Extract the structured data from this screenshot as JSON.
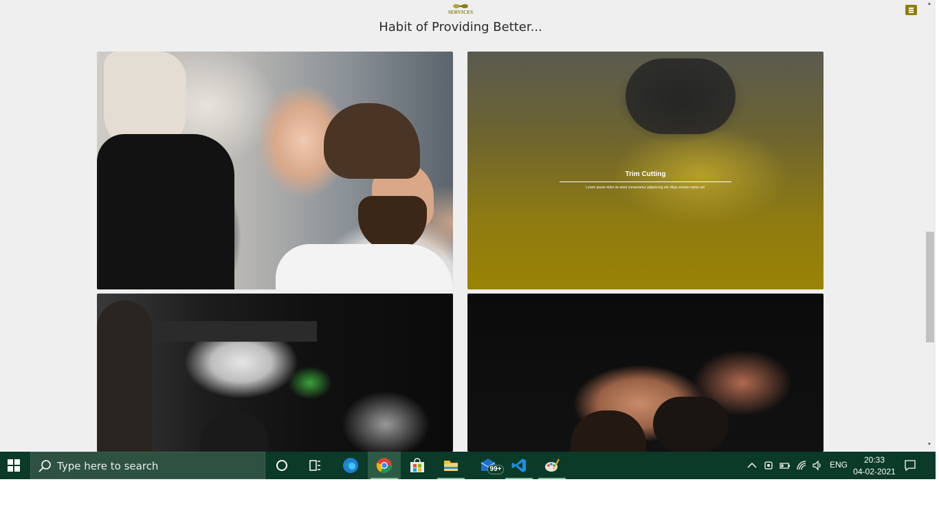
{
  "header": {
    "logo_text": "SERVICES",
    "section_title": "Habit of Providing Better..."
  },
  "menu": {
    "icon": "hamburger-menu-icon",
    "accent_color": "#8f7d0d"
  },
  "cards": [
    {
      "image": "hairstylist-cutting-mans-hair-photo"
    },
    {
      "image": "barber-shaving-beard-photo",
      "title": "Trim Cutting",
      "description": "Lorem ipsum dolor sit amet consectetur adipisicing elit. Alias veniam nemo vel.",
      "overlay_color": "#9a8306"
    },
    {
      "image": "barber-spraying-water-photo"
    },
    {
      "image": "barber-washing-hair-photo"
    }
  ],
  "taskbar": {
    "search_placeholder": "Type here to search",
    "apps": [
      "cortana-icon",
      "task-view-icon",
      "edge-icon",
      "chrome-icon",
      "store-icon",
      "file-explorer-icon",
      "mail-icon",
      "vscode-icon",
      "paint-icon"
    ],
    "mail_badge": "99+",
    "language": "ENG",
    "time": "20:33",
    "date": "04-02-2021"
  }
}
